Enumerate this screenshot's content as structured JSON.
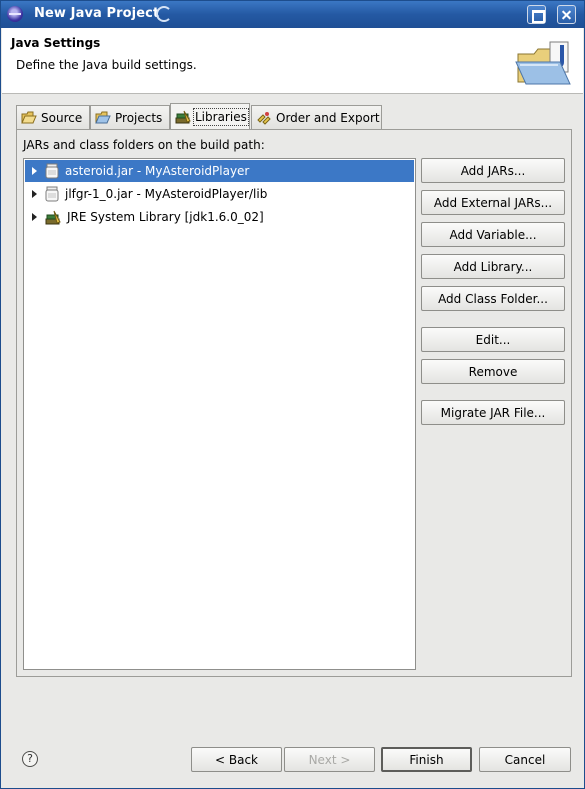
{
  "window": {
    "title": "New Java Project"
  },
  "header": {
    "title": "Java Settings",
    "description": "Define the Java build settings."
  },
  "tabs": [
    {
      "label": "Source",
      "icon": "source-folder-icon",
      "active": false
    },
    {
      "label": "Projects",
      "icon": "projects-folder-icon",
      "active": false
    },
    {
      "label": "Libraries",
      "icon": "libraries-icon",
      "active": true
    },
    {
      "label": "Order and Export",
      "icon": "order-export-icon",
      "active": false
    }
  ],
  "libraries": {
    "caption": "JARs and class folders on the build path:",
    "entries": [
      {
        "label": "asteroid.jar - MyAsteroidPlayer",
        "icon": "jar-icon",
        "selected": true
      },
      {
        "label": "jlfgr-1_0.jar - MyAsteroidPlayer/lib",
        "icon": "jar-icon",
        "selected": false
      },
      {
        "label": "JRE System Library [jdk1.6.0_02]",
        "icon": "jre-library-icon",
        "selected": false
      }
    ],
    "buttons": {
      "add_jars": "Add JARs...",
      "add_external_jars": "Add External JARs...",
      "add_variable": "Add Variable...",
      "add_library": "Add Library...",
      "add_class_folder": "Add Class Folder...",
      "edit": "Edit...",
      "remove": "Remove",
      "migrate_jar": "Migrate JAR File..."
    }
  },
  "footer": {
    "help": "?",
    "back": "< Back",
    "next": "Next >",
    "finish": "Finish",
    "cancel": "Cancel"
  },
  "colors": {
    "titlebar": "#2459a3",
    "selection": "#3c78c6",
    "window_bg": "#e9e9e7"
  }
}
